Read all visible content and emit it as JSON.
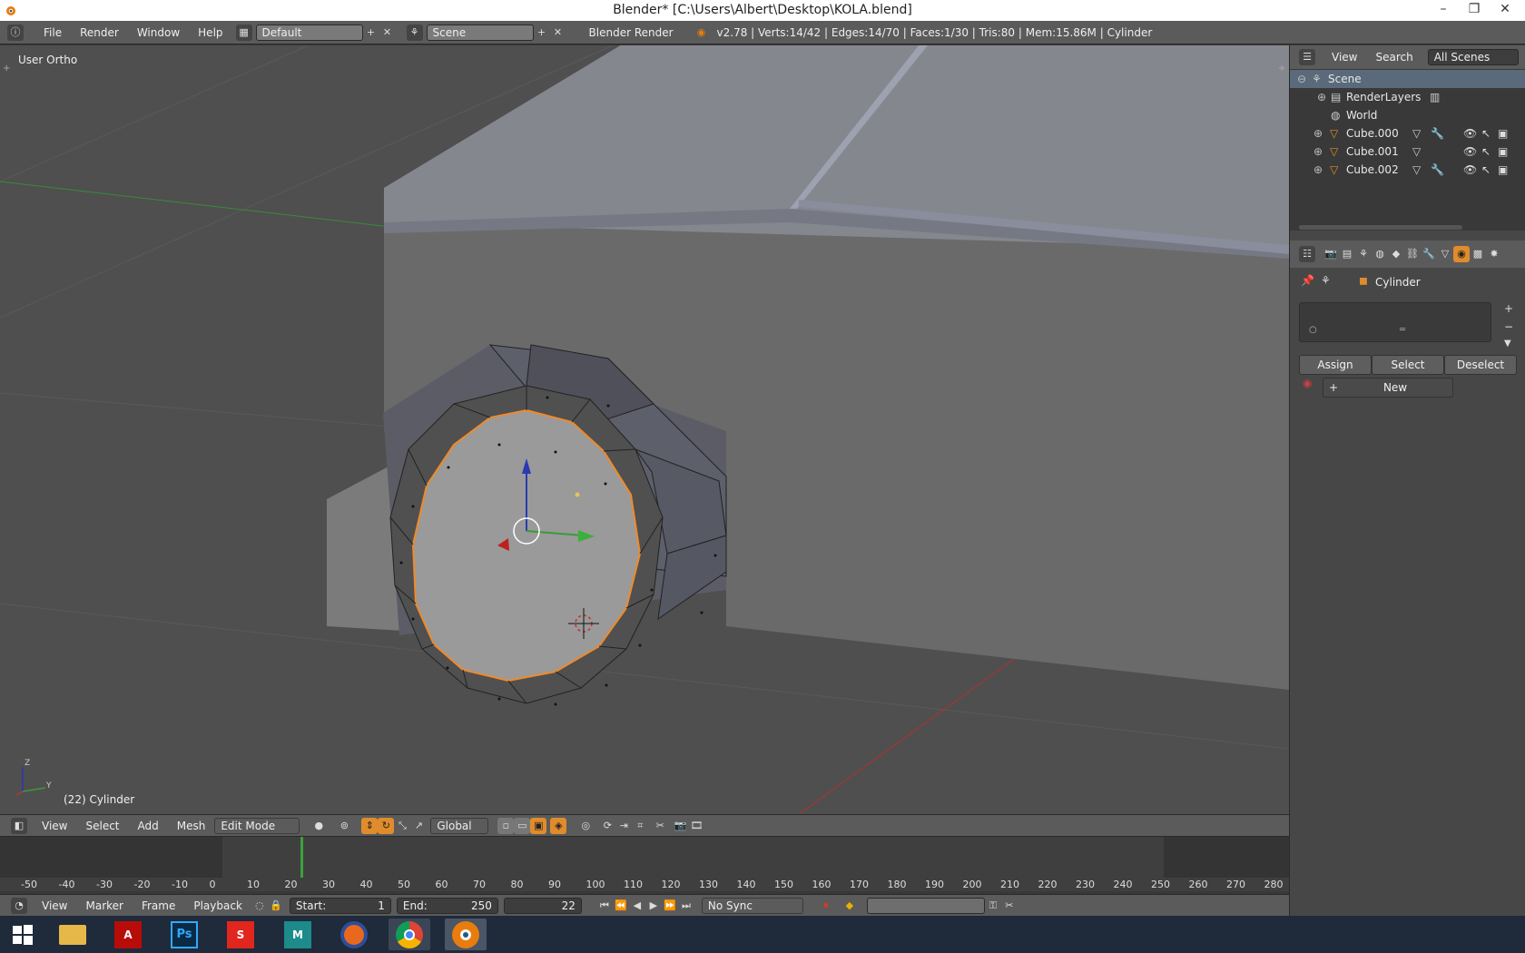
{
  "window": {
    "title": "Blender* [C:\\Users\\Albert\\Desktop\\KOLA.blend]"
  },
  "info_header": {
    "menus": [
      "File",
      "Render",
      "Window",
      "Help"
    ],
    "layout": "Default",
    "scene": "Scene",
    "engine": "Blender Render",
    "stats": "v2.78 | Verts:14/42 | Edges:14/70 | Faces:1/30 | Tris:80 | Mem:15.86M | Cylinder"
  },
  "viewport": {
    "view_label": "User Ortho",
    "object_label": "(22) Cylinder"
  },
  "view3d_header": {
    "menus": [
      "View",
      "Select",
      "Add",
      "Mesh"
    ],
    "mode": "Edit Mode",
    "orientation": "Global"
  },
  "timeline": {
    "ticks": [
      "-50",
      "-40",
      "-30",
      "-20",
      "-10",
      "0",
      "10",
      "20",
      "30",
      "40",
      "50",
      "60",
      "70",
      "80",
      "90",
      "100",
      "110",
      "120",
      "130",
      "140",
      "150",
      "160",
      "170",
      "180",
      "190",
      "200",
      "210",
      "220",
      "230",
      "240",
      "250",
      "260",
      "270",
      "280"
    ],
    "current_frame": 22
  },
  "timeline_header": {
    "menus": [
      "View",
      "Marker",
      "Frame",
      "Playback"
    ],
    "start_label": "Start:",
    "start_value": "1",
    "end_label": "End:",
    "end_value": "250",
    "frame_value": "22",
    "sync": "No Sync"
  },
  "outliner": {
    "menus": [
      "View",
      "Search"
    ],
    "filter": "All Scenes",
    "items": [
      {
        "label": "Scene",
        "icon": "scene-icon"
      },
      {
        "label": "RenderLayers",
        "icon": "renderlayers-icon"
      },
      {
        "label": "World",
        "icon": "world-icon"
      },
      {
        "label": "Cube.000",
        "icon": "mesh-icon"
      },
      {
        "label": "Cube.001",
        "icon": "mesh-icon"
      },
      {
        "label": "Cube.002",
        "icon": "mesh-icon"
      }
    ]
  },
  "properties": {
    "context_object": "Cylinder",
    "buttons": {
      "assign": "Assign",
      "select": "Select",
      "deselect": "Deselect",
      "new": "New"
    }
  },
  "colors": {
    "accent": "#e08c2c",
    "selected_edge": "#f08a2a",
    "x_axis": "#b03030",
    "y_axis": "#3a8a3a",
    "z_axis": "#2a3ab0"
  }
}
